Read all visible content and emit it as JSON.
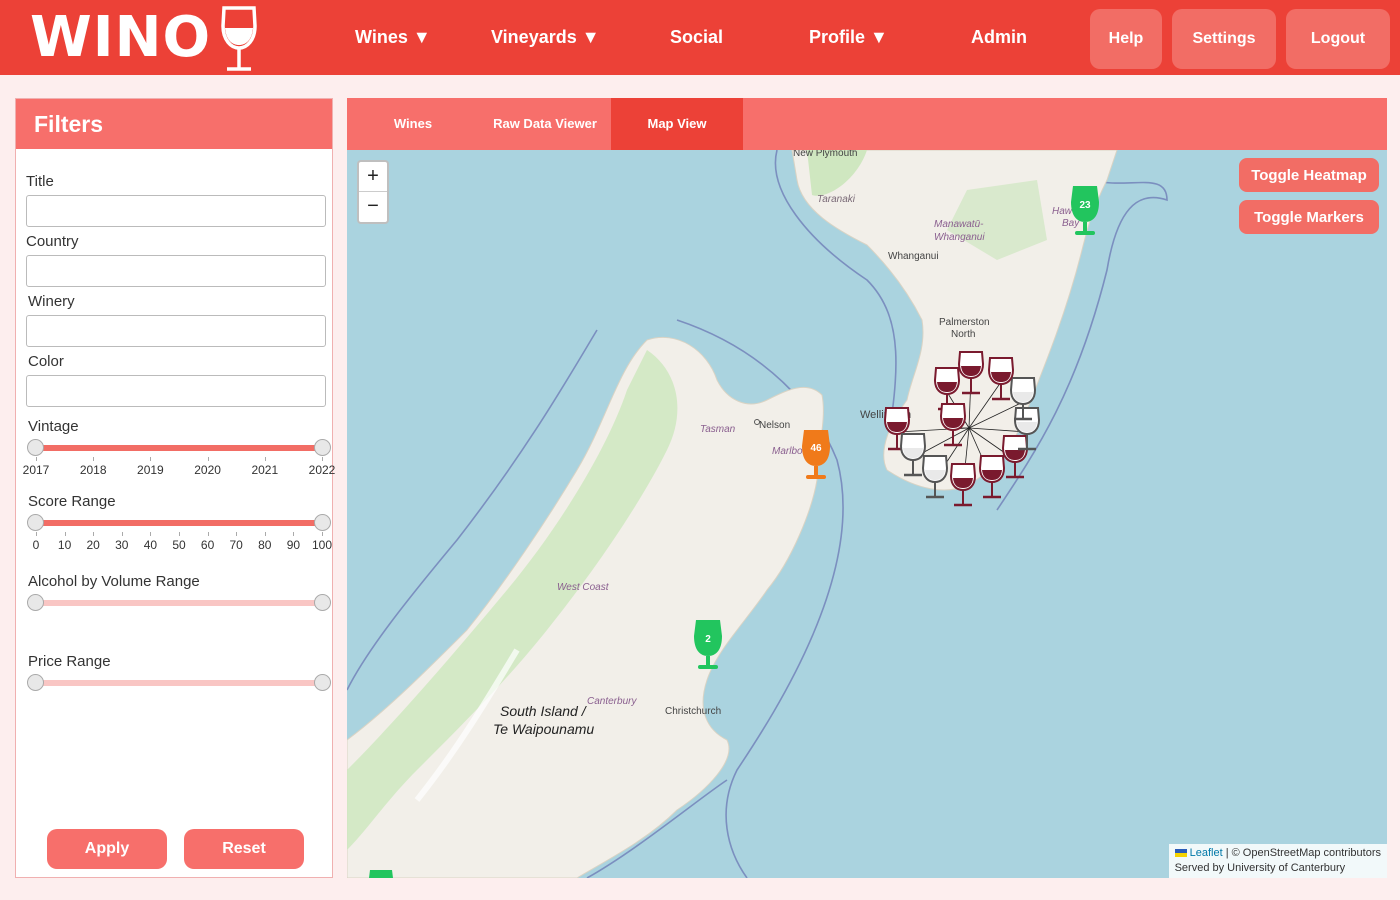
{
  "app": {
    "logo": "WINO"
  },
  "nav": {
    "items": [
      "Wines ▼",
      "Vineyards ▼",
      "Social",
      "Profile ▼",
      "Admin"
    ],
    "buttons": [
      "Help",
      "Settings",
      "Logout"
    ]
  },
  "filters": {
    "title": "Filters",
    "fields": [
      {
        "label": "Title",
        "value": ""
      },
      {
        "label": "Country",
        "value": ""
      },
      {
        "label": "Winery",
        "value": ""
      },
      {
        "label": "Color",
        "value": ""
      }
    ],
    "vintage": {
      "label": "Vintage",
      "ticks": [
        "2017",
        "2018",
        "2019",
        "2020",
        "2021",
        "2022"
      ],
      "min": 2017,
      "max": 2022
    },
    "score": {
      "label": "Score Range",
      "ticks": [
        "0",
        "10",
        "20",
        "30",
        "40",
        "50",
        "60",
        "70",
        "80",
        "90",
        "100"
      ],
      "min": 0,
      "max": 100
    },
    "abv": {
      "label": "Alcohol by Volume Range"
    },
    "price": {
      "label": "Price Range"
    },
    "apply_label": "Apply",
    "reset_label": "Reset"
  },
  "tabs": {
    "items": [
      "Wines",
      "Raw Data Viewer",
      "Map View"
    ],
    "active": "Map View"
  },
  "map": {
    "zoom_in": "+",
    "zoom_out": "−",
    "toggle_heatmap": "Toggle Heatmap",
    "toggle_markers": "Toggle Markers",
    "places": {
      "new_plymouth": "New Plymouth",
      "taranaki": "Taranaki",
      "manawatu1": "Manawatū-",
      "manawatu2": "Whanganui",
      "whanganui": "Whanganui",
      "hawkes1": "Haw",
      "hawkes2": "Bay",
      "palmerston1": "Palmerston",
      "palmerston2": "North",
      "wellington": "Wellington",
      "tasman": "Tasman",
      "nelson": "Nelson",
      "marlborough": "Marlborough",
      "west_coast": "West Coast",
      "canterbury": "Canterbury",
      "christchurch": "Christchurch",
      "south_island1": "South Island /",
      "south_island2": "Te Waipounamu"
    },
    "clusters": [
      {
        "count": "23",
        "color": "#22c55e"
      },
      {
        "count": "46",
        "color": "#f07a1a"
      },
      {
        "count": "2",
        "color": "#22c55e"
      }
    ],
    "attribution": {
      "leaflet": "Leaflet",
      "osm": "| © OpenStreetMap contributors",
      "served": "Served by University of Canterbury"
    }
  }
}
